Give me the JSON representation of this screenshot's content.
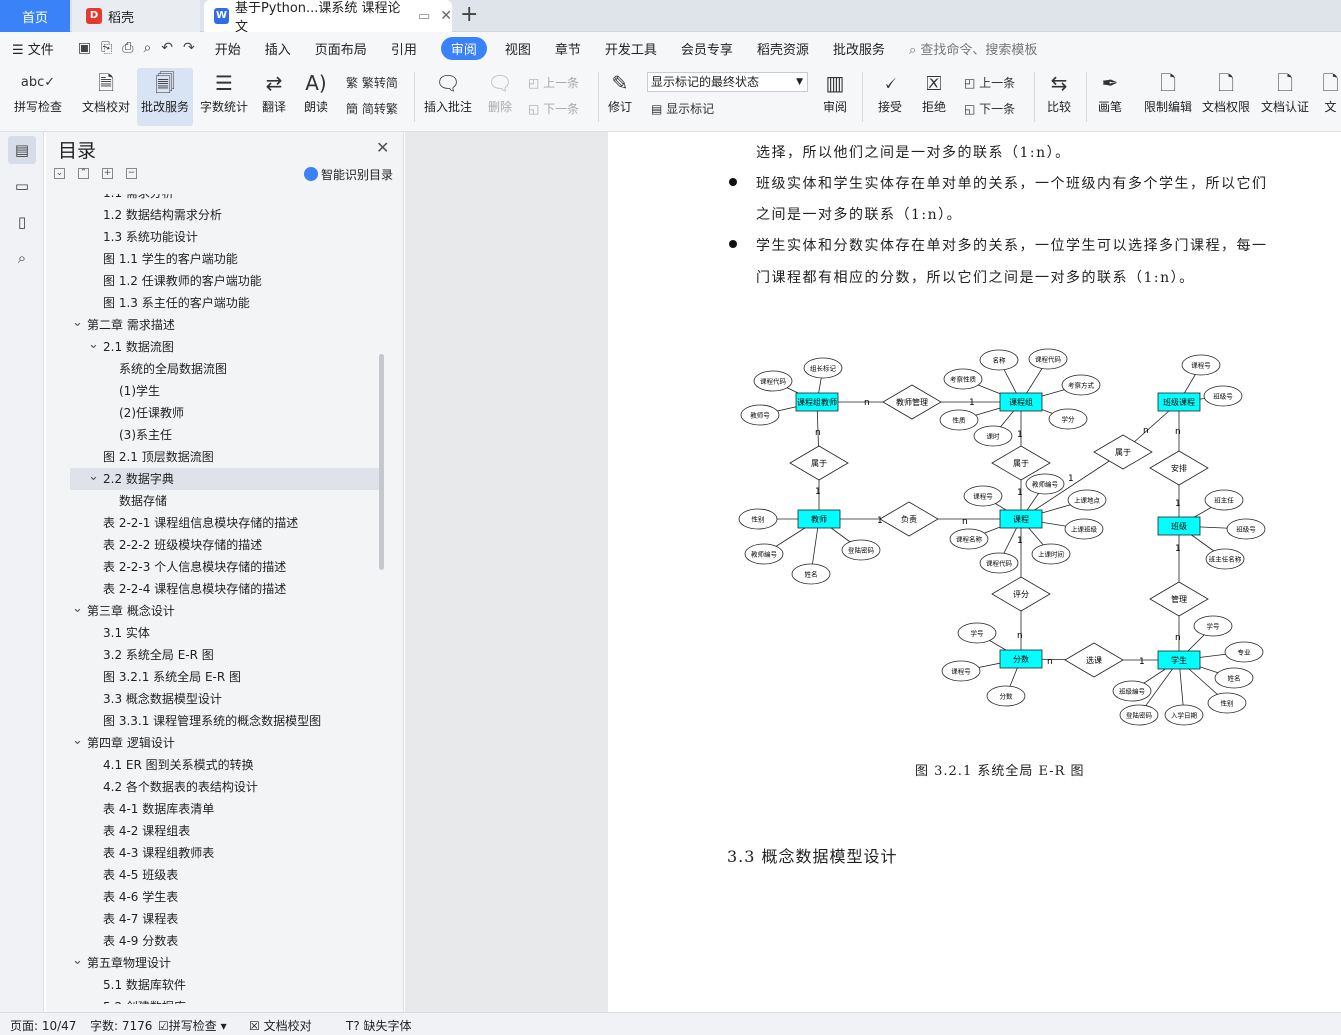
{
  "tabs": [
    {
      "label": "首页"
    },
    {
      "label": "稻壳"
    },
    {
      "label": "基于Python...课系统 课程论文"
    }
  ],
  "menu": {
    "file": "文件",
    "items": [
      "开始",
      "插入",
      "页面布局",
      "引用",
      "审阅",
      "视图",
      "章节",
      "开发工具",
      "会员专享",
      "稻壳资源",
      "批改服务"
    ],
    "active": "审阅",
    "search": "查找命令、搜索模板"
  },
  "ribbon": {
    "spellcheck": "拼写检查",
    "doc_check": "文档校对",
    "review_service": "批改服务",
    "word_count": "字数统计",
    "translate": "翻译",
    "read_aloud": "朗读",
    "trad": "繁转简",
    "simp": "简转繁",
    "insert_comment": "插入批注",
    "delete": "删除",
    "prev": "上一条",
    "next": "下一条",
    "track": "修订",
    "state": "显示标记的最终状态",
    "show_markup": "显示标记",
    "review": "审阅",
    "accept": "接受",
    "reject": "拒绝",
    "prev2": "上一条",
    "next2": "下一条",
    "compare": "比较",
    "pen": "画笔",
    "restrict": "限制编辑",
    "permission": "文档权限",
    "certify": "文档认证",
    "more": "文"
  },
  "toc": {
    "title": "目录",
    "smart": "智能识别目录",
    "items": [
      {
        "text": "1.1 需求分析",
        "level": 2
      },
      {
        "text": "1.2  数据结构需求分析",
        "level": 2
      },
      {
        "text": "1.3 系统功能设计",
        "level": 2
      },
      {
        "text": "图 1.1  学生的客户端功能",
        "level": 2
      },
      {
        "text": "图 1.2  任课教师的客户端功能",
        "level": 2
      },
      {
        "text": "图 1.3  系主任的客户端功能",
        "level": 2
      },
      {
        "text": "第二章  需求描述",
        "level": 1,
        "caret": true
      },
      {
        "text": "2.1  数据流图",
        "level": 2,
        "caret": true
      },
      {
        "text": "系统的全局数据流图",
        "level": 3
      },
      {
        "text": "(1)学生",
        "level": 3
      },
      {
        "text": "(2)任课教师",
        "level": 3
      },
      {
        "text": "(3)系主任",
        "level": 3
      },
      {
        "text": "图 2.1  顶层数据流图",
        "level": 2
      },
      {
        "text": "2.2  数据字典",
        "level": 2,
        "caret": true,
        "selected": true
      },
      {
        "text": "数据存储",
        "level": 3
      },
      {
        "text": "表 2-2-1  课程组信息模块存储的描述",
        "level": 2
      },
      {
        "text": "表 2-2-2  班级模块存储的描述",
        "level": 2
      },
      {
        "text": "表 2-2-3  个人信息模块存储的描述",
        "level": 2
      },
      {
        "text": "表 2-2-4  课程信息模块存储的描述",
        "level": 2
      },
      {
        "text": "第三章    概念设计",
        "level": 1,
        "caret": true
      },
      {
        "text": "3.1  实体",
        "level": 2
      },
      {
        "text": "3.2  系统全局 E-R 图",
        "level": 2
      },
      {
        "text": "图 3.2.1  系统全局 E-R 图",
        "level": 2
      },
      {
        "text": "3.3  概念数据模型设计",
        "level": 2
      },
      {
        "text": "图 3.3.1  课程管理系统的概念数据模型图",
        "level": 2
      },
      {
        "text": "第四章  逻辑设计",
        "level": 1,
        "caret": true
      },
      {
        "text": "4.1 ER 图到关系模式的转换",
        "level": 2
      },
      {
        "text": "4.2    各个数据表的表结构设计",
        "level": 2
      },
      {
        "text": "表 4-1  数据库表清单",
        "level": 2
      },
      {
        "text": "表 4-2  课程组表",
        "level": 2
      },
      {
        "text": "表 4-3  课程组教师表",
        "level": 2
      },
      {
        "text": "表 4-5  班级表",
        "level": 2
      },
      {
        "text": "表 4-6  学生表",
        "level": 2
      },
      {
        "text": "表 4-7  课程表",
        "level": 2
      },
      {
        "text": "表 4-9  分数表",
        "level": 2
      },
      {
        "text": "第五章物理设计",
        "level": 1,
        "caret": true
      },
      {
        "text": "5.1  数据库软件",
        "level": 2
      },
      {
        "text": "5.2  创建数据库",
        "level": 2
      }
    ]
  },
  "doc": {
    "lines": [
      "选择，所以他们之间是一对多的联系（1:n）。",
      "班级实体和学生实体存在单对单的关系，一个班级内有多个学生，所以它们",
      "之间是一对多的联系（1:n）。",
      "学生实体和分数实体存在单对多的关系，一位学生可以选择多门课程，每一",
      "门课程都有相应的分数，所以它们之间是一对多的联系（1:n）。"
    ],
    "caption": "图 3.2.1  系统全局 E-R 图",
    "heading": "3.3  概念数据模型设计"
  },
  "er": {
    "entities": [
      {
        "id": "kczjs",
        "label": "课程组教师"
      },
      {
        "id": "kcz",
        "label": "课程组"
      },
      {
        "id": "bjkc",
        "label": "班级课程"
      },
      {
        "id": "js",
        "label": "教师"
      },
      {
        "id": "kc",
        "label": "课程"
      },
      {
        "id": "bj",
        "label": "班级"
      },
      {
        "id": "fs",
        "label": "分数"
      },
      {
        "id": "xs",
        "label": "学生"
      }
    ],
    "relations": [
      {
        "id": "jsgl",
        "label": "教师管理"
      },
      {
        "id": "sy1",
        "label": "属于"
      },
      {
        "id": "sy2",
        "label": "属于"
      },
      {
        "id": "sy3",
        "label": "属于"
      },
      {
        "id": "ap",
        "label": "安排"
      },
      {
        "id": "fz",
        "label": "负责"
      },
      {
        "id": "pf",
        "label": "评分"
      },
      {
        "id": "gl",
        "label": "管理"
      },
      {
        "id": "xk",
        "label": "选课"
      }
    ],
    "attributes": [
      "组长标记",
      "课程代码",
      "教师号",
      "名称",
      "课程代码",
      "考察性质",
      "考察方式",
      "性质",
      "学分",
      "课时",
      "课程号",
      "班级号",
      "性别",
      "教师编号",
      "登陆密码",
      "姓名",
      "课程号",
      "教师编号",
      "上课地点",
      "上课班级",
      "课程名称",
      "课程代码",
      "上课时间",
      "班主任",
      "班级号",
      "班主任名称",
      "学号",
      "课程号",
      "分数",
      "学号",
      "专业",
      "姓名",
      "性别",
      "班级编号",
      "登陆密码",
      "入学日期"
    ],
    "cardinality": {
      "one": "1",
      "many": "n"
    },
    "colors": {
      "entity": "#00ffff"
    }
  },
  "status": {
    "page": "页面: 10/47",
    "words": "字数: 7176",
    "spell": "拼写检查",
    "check": "文档校对",
    "font": "缺失字体"
  }
}
